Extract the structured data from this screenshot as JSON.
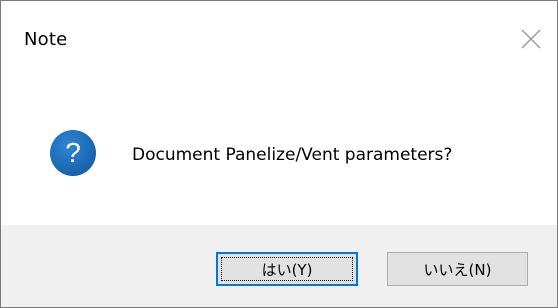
{
  "dialog": {
    "title": "Note",
    "message": "Document Panelize/Vent parameters?",
    "icon": "question-icon",
    "close_icon": "close-icon"
  },
  "buttons": {
    "yes_label": "はい(Y)",
    "no_label": "いいえ(N)"
  },
  "colors": {
    "icon_blue": "#1c6bb6",
    "focus_border": "#0078d7",
    "footer_bg": "#f0f0f0",
    "button_bg": "#e1e1e1"
  }
}
